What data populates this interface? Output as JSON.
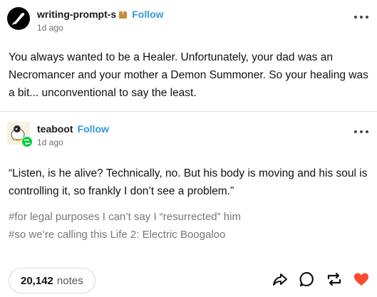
{
  "original_post": {
    "username": "writing-prompt-s",
    "follow_label": "Follow",
    "timestamp": "1d ago",
    "body": "You always wanted to be a Healer. Unfortunately, your dad was an Necromancer and your mother a Demon Summoner. So your healing was a bit... unconventional to say the least."
  },
  "reblog": {
    "username": "teaboot",
    "follow_label": "Follow",
    "timestamp": "1d ago",
    "body": "“Listen, is he alive? Technically, no. But his body is moving and his soul is controlling it, so frankly I don’t see a problem.”",
    "tags": [
      "#for legal purposes I can’t say I “resurrected” him",
      "#so we’re calling this Life 2: Electric Boogaloo"
    ]
  },
  "footer": {
    "notes_count": "20,142",
    "notes_label": "notes",
    "icons": [
      "share-icon",
      "reply-icon",
      "reblog-icon",
      "like-icon"
    ],
    "like_color": "#ff4930"
  },
  "colors": {
    "follow": "#2f9bd6",
    "badge": "#c98a3f",
    "verified": "#00cf35"
  }
}
